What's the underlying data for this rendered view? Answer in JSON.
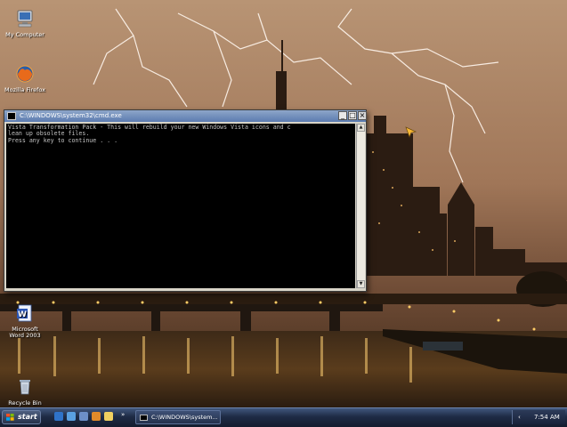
{
  "desktop": {
    "icons": [
      {
        "label": "My Computer",
        "icon": "computer-icon"
      },
      {
        "label": "Mozilla Firefox",
        "icon": "firefox-icon"
      },
      {
        "label_line1": "Microsoft",
        "label_line2": "Word 2003",
        "icon": "word-icon"
      },
      {
        "label": "Recycle Bin",
        "icon": "recycle-bin-icon"
      }
    ]
  },
  "console": {
    "title": "C:\\WINDOWS\\system32\\cmd.exe",
    "lines": [
      "Vista Transformation Pack - This will rebuild your new Windows Vista icons and c",
      "lean up obsolete files.",
      "Press any key to continue . . ."
    ],
    "minimize_glyph": "_",
    "maximize_glyph": "□",
    "close_glyph": "×",
    "scroll_up_glyph": "▲",
    "scroll_down_glyph": "▼"
  },
  "taskbar": {
    "start_label": "start",
    "expand_glyph": "»",
    "task_label": "C:\\WINDOWS\\system...",
    "tray_chevron": "‹",
    "clock": "7:54 AM"
  },
  "colors": {
    "taskbar": "#1e2b45",
    "sky": "#a07a5a",
    "console_bg": "#000000",
    "console_text": "#c0c0c0"
  }
}
